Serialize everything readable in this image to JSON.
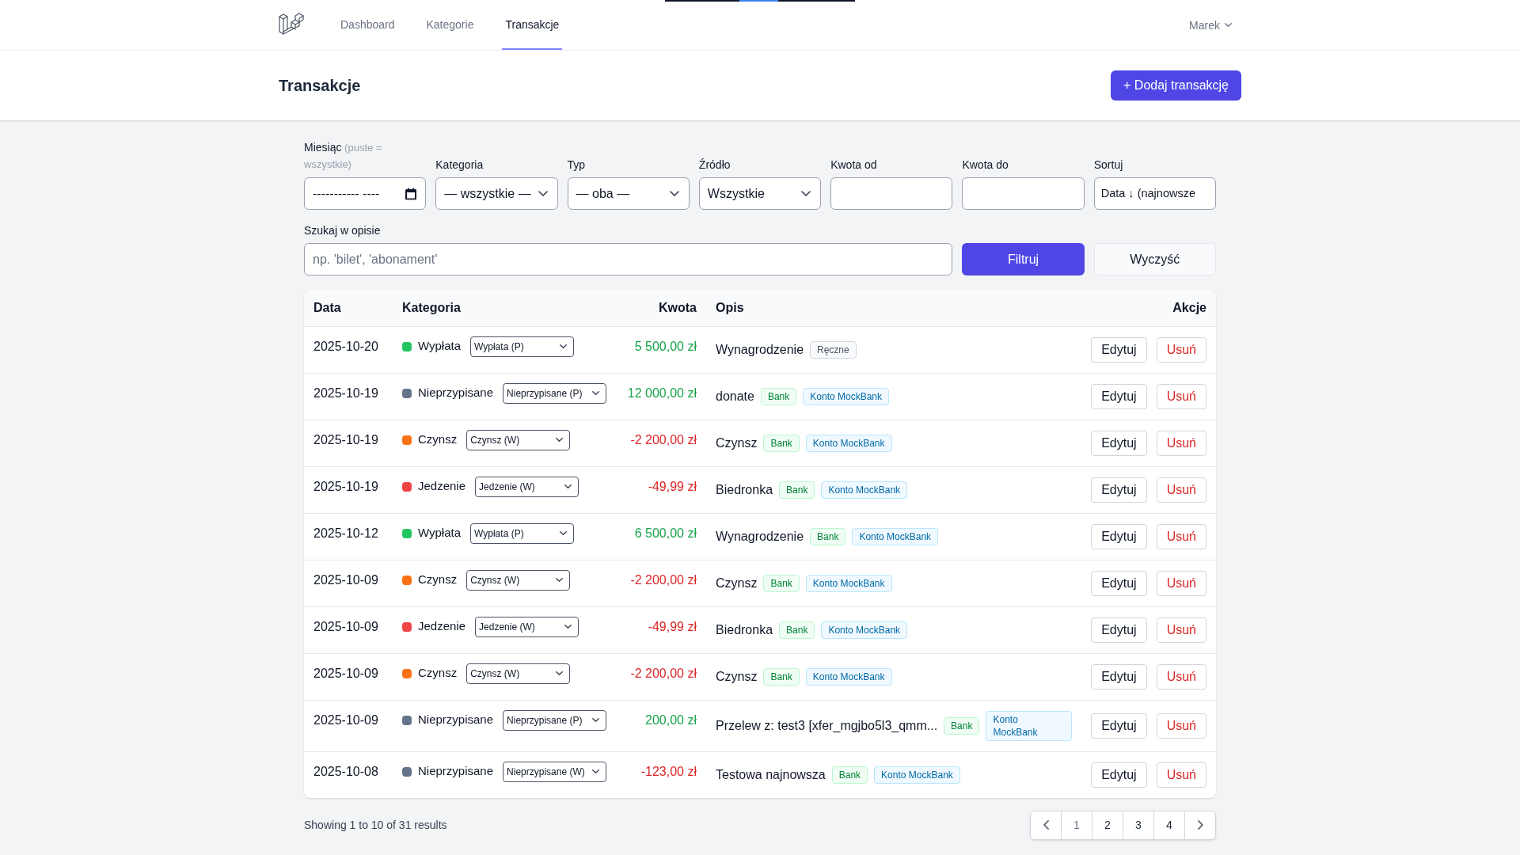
{
  "nav": {
    "links": [
      {
        "label": "Dashboard",
        "selected": false
      },
      {
        "label": "Kategorie",
        "selected": false
      },
      {
        "label": "Transakcje",
        "selected": true
      }
    ],
    "user": "Marek"
  },
  "header": {
    "title": "Transakcje",
    "add_button": "+ Dodaj transakcję"
  },
  "filters": [
    {
      "kind": "month",
      "label": "Miesiąc",
      "hint": "(puste = wszystkie)",
      "placeholder": "----------- ----"
    },
    {
      "kind": "select",
      "label": "Kategoria",
      "value": "— wszystkie —"
    },
    {
      "kind": "select",
      "label": "Typ",
      "value": "— oba —"
    },
    {
      "kind": "select",
      "label": "Źródło",
      "value": "Wszystkie"
    },
    {
      "kind": "input",
      "label": "Kwota od"
    },
    {
      "kind": "input",
      "label": "Kwota do"
    },
    {
      "kind": "sort",
      "label": "Sortuj",
      "value": "Data ↓ (najnowsze"
    }
  ],
  "search": {
    "label": "Szukaj w opisie",
    "placeholder": "np. 'bilet', 'abonament'"
  },
  "buttons": {
    "filter": "Filtruj",
    "clear": "Wyczyść"
  },
  "table": {
    "columns": [
      "Data",
      "Kategoria",
      "Kwota",
      "Opis",
      "Akcje"
    ],
    "rows": [
      {
        "date": "2025-10-20",
        "category": "Wypłata",
        "color": "#22c55e",
        "category_select": "Wypłata (P)",
        "amount": "5 500,00 zł",
        "kind": "income",
        "description": "Wynagrodzenie",
        "tags": [
          {
            "label": "Ręczne",
            "kind": "manual"
          }
        ],
        "actions": [
          "Edytuj",
          "Usuń"
        ]
      },
      {
        "date": "2025-10-19",
        "category": "Nieprzypisane",
        "color": "#64748b",
        "category_select": "Nieprzypisane (P)",
        "amount": "12 000,00 zł",
        "kind": "income",
        "description": "donate",
        "tags": [
          {
            "label": "Bank",
            "kind": "bank"
          },
          {
            "label": "Konto MockBank",
            "kind": "account"
          }
        ],
        "actions": [
          "Edytuj",
          "Usuń"
        ]
      },
      {
        "date": "2025-10-19",
        "category": "Czynsz",
        "color": "#f97316",
        "category_select": "Czynsz (W)",
        "amount": "-2 200,00 zł",
        "kind": "expense",
        "description": "Czynsz",
        "tags": [
          {
            "label": "Bank",
            "kind": "bank"
          },
          {
            "label": "Konto MockBank",
            "kind": "account"
          }
        ],
        "actions": [
          "Edytuj",
          "Usuń"
        ]
      },
      {
        "date": "2025-10-19",
        "category": "Jedzenie",
        "color": "#ef4444",
        "category_select": "Jedzenie (W)",
        "amount": "-49,99 zł",
        "kind": "expense",
        "description": "Biedronka",
        "tags": [
          {
            "label": "Bank",
            "kind": "bank"
          },
          {
            "label": "Konto MockBank",
            "kind": "account"
          }
        ],
        "actions": [
          "Edytuj",
          "Usuń"
        ]
      },
      {
        "date": "2025-10-12",
        "category": "Wypłata",
        "color": "#22c55e",
        "category_select": "Wypłata (P)",
        "amount": "6 500,00 zł",
        "kind": "income",
        "description": "Wynagrodzenie",
        "tags": [
          {
            "label": "Bank",
            "kind": "bank"
          },
          {
            "label": "Konto MockBank",
            "kind": "account"
          }
        ],
        "actions": [
          "Edytuj",
          "Usuń"
        ]
      },
      {
        "date": "2025-10-09",
        "category": "Czynsz",
        "color": "#f97316",
        "category_select": "Czynsz (W)",
        "amount": "-2 200,00 zł",
        "kind": "expense",
        "description": "Czynsz",
        "tags": [
          {
            "label": "Bank",
            "kind": "bank"
          },
          {
            "label": "Konto MockBank",
            "kind": "account"
          }
        ],
        "actions": [
          "Edytuj",
          "Usuń"
        ]
      },
      {
        "date": "2025-10-09",
        "category": "Jedzenie",
        "color": "#ef4444",
        "category_select": "Jedzenie (W)",
        "amount": "-49,99 zł",
        "kind": "expense",
        "description": "Biedronka",
        "tags": [
          {
            "label": "Bank",
            "kind": "bank"
          },
          {
            "label": "Konto MockBank",
            "kind": "account"
          }
        ],
        "actions": [
          "Edytuj",
          "Usuń"
        ]
      },
      {
        "date": "2025-10-09",
        "category": "Czynsz",
        "color": "#f97316",
        "category_select": "Czynsz (W)",
        "amount": "-2 200,00 zł",
        "kind": "expense",
        "description": "Czynsz",
        "tags": [
          {
            "label": "Bank",
            "kind": "bank"
          },
          {
            "label": "Konto MockBank",
            "kind": "account"
          }
        ],
        "actions": [
          "Edytuj",
          "Usuń"
        ]
      },
      {
        "date": "2025-10-09",
        "category": "Nieprzypisane",
        "color": "#64748b",
        "category_select": "Nieprzypisane (P)",
        "amount": "200,00 zł",
        "kind": "income",
        "description": "Przelew z: test3 [xfer_mgjbo5l3_qmm...",
        "tags": [
          {
            "label": "Bank",
            "kind": "bank"
          },
          {
            "label": "Konto MockBank",
            "kind": "account"
          }
        ],
        "actions": [
          "Edytuj",
          "Usuń"
        ]
      },
      {
        "date": "2025-10-08",
        "category": "Nieprzypisane",
        "color": "#64748b",
        "category_select": "Nieprzypisane (W)",
        "amount": "-123,00 zł",
        "kind": "expense",
        "description": "Testowa najnowsza",
        "tags": [
          {
            "label": "Bank",
            "kind": "bank"
          },
          {
            "label": "Konto MockBank",
            "kind": "account"
          }
        ],
        "actions": [
          "Edytuj",
          "Usuń"
        ]
      }
    ]
  },
  "pagination": {
    "summary": "Showing 1 to 10 of 31 results",
    "pages": [
      {
        "label": "1",
        "selected": true
      },
      {
        "label": "2",
        "selected": false
      },
      {
        "label": "3",
        "selected": false
      },
      {
        "label": "4",
        "selected": false
      }
    ]
  }
}
